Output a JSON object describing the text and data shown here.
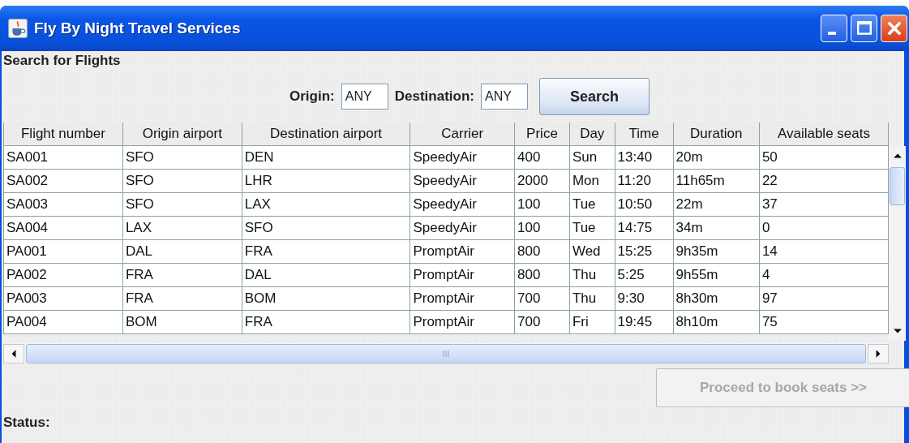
{
  "window": {
    "title": "Fly By Night Travel Services"
  },
  "heading": "Search for Flights",
  "search_form": {
    "origin": {
      "label": "Origin:",
      "value": "ANY"
    },
    "destination": {
      "label": "Destination:",
      "value": "ANY"
    },
    "button": "Search"
  },
  "table": {
    "columns": [
      "Flight number",
      "Origin airport",
      "Destination airport",
      "Carrier",
      "Price",
      "Day",
      "Time",
      "Duration",
      "Available seats"
    ],
    "rows": [
      [
        "SA001",
        "SFO",
        "DEN",
        "SpeedyAir",
        "400",
        "Sun",
        "13:40",
        "20m",
        "50"
      ],
      [
        "SA002",
        "SFO",
        "LHR",
        "SpeedyAir",
        "2000",
        "Mon",
        "11:20",
        "11h65m",
        "22"
      ],
      [
        "SA003",
        "SFO",
        "LAX",
        "SpeedyAir",
        "100",
        "Tue",
        "10:50",
        "22m",
        "37"
      ],
      [
        "SA004",
        "LAX",
        "SFO",
        "SpeedyAir",
        "100",
        "Tue",
        "14:75",
        "34m",
        "0"
      ],
      [
        "PA001",
        "DAL",
        "FRA",
        "PromptAir",
        "800",
        "Wed",
        "15:25",
        "9h35m",
        "14"
      ],
      [
        "PA002",
        "FRA",
        "DAL",
        "PromptAir",
        "800",
        "Thu",
        "5:25",
        "9h55m",
        "4"
      ],
      [
        "PA003",
        "FRA",
        "BOM",
        "PromptAir",
        "700",
        "Thu",
        "9:30",
        "8h30m",
        "97"
      ],
      [
        "PA004",
        "BOM",
        "FRA",
        "PromptAir",
        "700",
        "Fri",
        "19:45",
        "8h10m",
        "75"
      ]
    ]
  },
  "proceed_button": {
    "label": "Proceed to book seats >>",
    "disabled": true
  },
  "status_label": "Status:"
}
